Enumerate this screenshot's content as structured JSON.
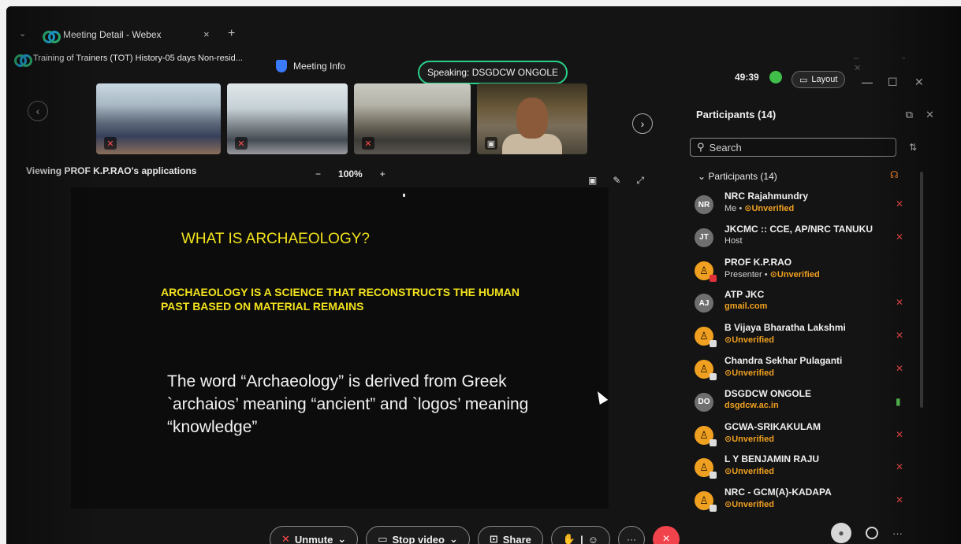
{
  "browser": {
    "tab_title": "Meeting Detail - Webex",
    "tab_close": "×",
    "new_tab": "+",
    "chevron": "⌄"
  },
  "meeting": {
    "title": "Training of Trainers (TOT) History-05 days Non-resid...",
    "info_label": "Meeting Info",
    "speaking": "Speaking: DSGDCW ONGOLE",
    "timer": "49:39",
    "layout_label": "Layout"
  },
  "viewing": {
    "label": "Viewing PROF  K.P.RAO's applications",
    "zoom_minus": "−",
    "zoom_pct": "100%",
    "zoom_plus": "+"
  },
  "slide": {
    "heading": "WHAT IS ARCHAEOLOGY?",
    "subheading": "ARCHAEOLOGY IS A SCIENCE THAT RECONSTRUCTS THE HUMAN PAST BASED ON MATERIAL REMAINS",
    "body": "The word “Archaeology” is derived from Greek `archaios’ meaning “ancient” and `logos’ meaning “knowledge”"
  },
  "participants_panel": {
    "title": "Participants (14)",
    "search_placeholder": "Search",
    "group_label": "Participants (14)",
    "items": [
      {
        "initials": "NR",
        "name": "NRC Rajahmundry",
        "sub_prefix": "Me • ",
        "sub_status": "Unverified",
        "avatar": "gray",
        "mic": "muted"
      },
      {
        "initials": "JT",
        "name": "JKCMC :: CCE, AP/NRC TANUKU",
        "sub_prefix": "Host",
        "sub_status": "",
        "avatar": "gray",
        "mic": "muted"
      },
      {
        "initials": "",
        "name": "PROF  K.P.RAO",
        "sub_prefix": "Presenter • ",
        "sub_status": "Unverified",
        "avatar": "orange",
        "mic": "none"
      },
      {
        "initials": "AJ",
        "name": "ATP JKC",
        "sub_prefix": "",
        "sub_status": "gmail.com",
        "avatar": "gray",
        "mic": "muted"
      },
      {
        "initials": "",
        "name": "B Vijaya Bharatha Lakshmi",
        "sub_prefix": "",
        "sub_status": "Unverified",
        "avatar": "orange",
        "mic": "muted"
      },
      {
        "initials": "",
        "name": "Chandra Sekhar Pulaganti",
        "sub_prefix": "",
        "sub_status": "Unverified",
        "avatar": "orange",
        "mic": "muted"
      },
      {
        "initials": "DO",
        "name": "DSGDCW ONGOLE",
        "sub_prefix": "",
        "sub_status": "dsgdcw.ac.in",
        "avatar": "gray",
        "mic": "active"
      },
      {
        "initials": "",
        "name": "GCWA-SRIKAKULAM",
        "sub_prefix": "",
        "sub_status": "Unverified",
        "avatar": "orange",
        "mic": "muted"
      },
      {
        "initials": "",
        "name": "L Y BENJAMIN RAJU",
        "sub_prefix": "",
        "sub_status": "Unverified",
        "avatar": "orange",
        "mic": "muted"
      },
      {
        "initials": "",
        "name": "NRC - GCM(A)-KADAPA",
        "sub_prefix": "",
        "sub_status": "Unverified",
        "avatar": "orange",
        "mic": "muted"
      }
    ]
  },
  "controls": {
    "unmute": "Unmute",
    "stop_video": "Stop video",
    "share": "Share",
    "more": "···",
    "end": "×"
  },
  "colors": {
    "accent_green": "#2ad08a",
    "slide_yellow": "#f2e21c",
    "unverified_orange": "#f0a020",
    "end_red": "#f0434b"
  }
}
